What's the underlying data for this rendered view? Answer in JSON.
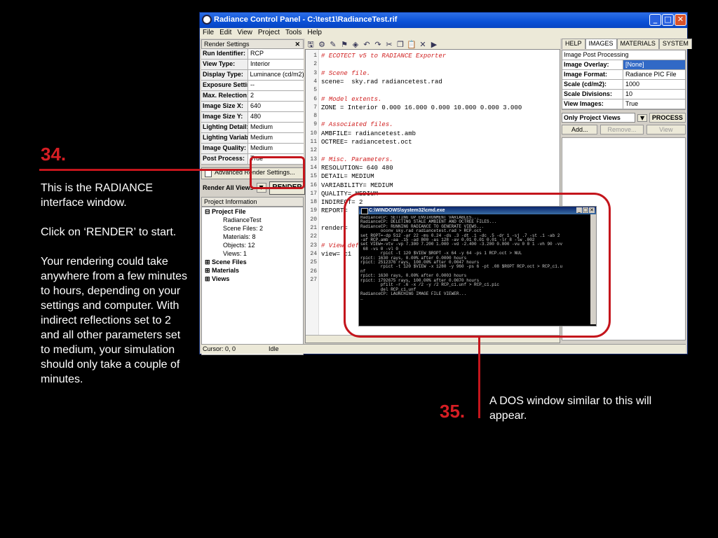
{
  "window": {
    "title": "Radiance Control Panel - C:\\test1\\RadianceTest.rif",
    "menu": [
      "File",
      "Edit",
      "View",
      "Project",
      "Tools",
      "Help"
    ]
  },
  "render_settings": {
    "header": "Render Settings",
    "rows": [
      {
        "label": "Run Identifier:",
        "value": "RCP"
      },
      {
        "label": "View Type:",
        "value": "Interior"
      },
      {
        "label": "Display Type:",
        "value": "Luminance (cd/m2)"
      },
      {
        "label": "Exposure Settin",
        "value": "--"
      },
      {
        "label": "Max. Relection:",
        "value": "2"
      },
      {
        "label": "Image Size X:",
        "value": "640"
      },
      {
        "label": "Image Size Y:",
        "value": "480"
      },
      {
        "label": "Lighting Detail:",
        "value": "Medium"
      },
      {
        "label": "Lighting Variabi",
        "value": "Medium"
      },
      {
        "label": "Image Quality:",
        "value": "Medium"
      },
      {
        "label": "Post Process:",
        "value": "True"
      }
    ],
    "advanced_label": "Advanced Render Settings...",
    "render_views_label": "Render All Views",
    "render_button": "RENDER"
  },
  "project_info": {
    "header": "Project Information",
    "items": [
      "Project File",
      "RadianceTest",
      "Scene Files: 2",
      "Materials: 8",
      "Objects: 12",
      "Views: 1",
      "Scene Files",
      "Materials",
      "Views"
    ]
  },
  "editor": {
    "lines": [
      {
        "n": "1",
        "text": "# ECOTECT v5 to RADIANCE Exporter",
        "comment": true
      },
      {
        "n": "2",
        "text": ""
      },
      {
        "n": "3",
        "text": "# Scene file.",
        "comment": true
      },
      {
        "n": "4",
        "text": "scene=  sky.rad radiancetest.rad"
      },
      {
        "n": "5",
        "text": ""
      },
      {
        "n": "6",
        "text": "# Model extents.",
        "comment": true
      },
      {
        "n": "7",
        "text": "ZONE = Interior 0.000 16.000 0.000 10.000 0.000 3.000"
      },
      {
        "n": "8",
        "text": ""
      },
      {
        "n": "9",
        "text": "# Associated files.",
        "comment": true
      },
      {
        "n": "10",
        "text": "AMBFILE= radiancetest.amb"
      },
      {
        "n": "11",
        "text": "OCTREE= radiancetest.oct"
      },
      {
        "n": "12",
        "text": ""
      },
      {
        "n": "13",
        "text": "# Misc. Parameters.",
        "comment": true
      },
      {
        "n": "14",
        "text": "RESOLUTION= 640 480"
      },
      {
        "n": "15",
        "text": "DETAIL= MEDIUM"
      },
      {
        "n": "16",
        "text": "VARIABILITY= MEDIUM"
      },
      {
        "n": "17",
        "text": "QUALITY= MEDIUM"
      },
      {
        "n": "18",
        "text": "INDIRECT= 2"
      },
      {
        "n": "19",
        "text": "REPORT="
      },
      {
        "n": "20",
        "text": ""
      },
      {
        "n": "21",
        "text": "render="
      },
      {
        "n": "22",
        "text": ""
      },
      {
        "n": "23",
        "text": "# View def",
        "comment": true
      },
      {
        "n": "24",
        "text": "view= c1"
      },
      {
        "n": "25",
        "text": ""
      },
      {
        "n": "26",
        "text": ""
      },
      {
        "n": "27",
        "text": ""
      }
    ]
  },
  "right_panel": {
    "tabs": [
      "HELP",
      "IMAGES",
      "MATERIALS",
      "SYSTEM"
    ],
    "section": "Image Post Processing",
    "rows": [
      {
        "label": "Image Overlay:",
        "value": "[None]"
      },
      {
        "label": "Image Format:",
        "value": "Radiance PIC File"
      },
      {
        "label": "Scale (cd/m2):",
        "value": "1000"
      },
      {
        "label": "Scale Divisions:",
        "value": "10"
      },
      {
        "label": "View Images:",
        "value": "True"
      }
    ],
    "filter": "Only Project Views",
    "process_button": "PROCESS",
    "add_button": "Add...",
    "remove_button": "Remove...",
    "view_button": "View"
  },
  "status": {
    "cursor": "Cursor: 0, 0",
    "state": "Idle"
  },
  "dos": {
    "title": "C:\\WINDOWS\\system32\\cmd.exe",
    "text": "RadianceCP: SETTING UP ENVIRONMENT VARIABLES...\nRadianceCP: DELETING STALE AMBIENT AND OCTREE FILES...\nRadianceCP: RUNNING RADIANCE TO GENERATE VIEWS...\n        oconv sky.rad radiancetest.rad > RCP.oct\nset ROPT=-dp 512 -ar 22 -ms 0.24 -ds .3 -dt .1 -dc .5 -dr 1 -sj .7 -st .1 -ab 2\n-af RCP.amb -aa .15 -ad 800 -as 128 -av 0.01 0.01 0.01 -lr 8 -lw .002\nset VIEW=-vtv -vp 7.300 7.200 1.000 -vd -2.400 -3.200 0.000 -vu 0 0 1 -vh 90 -vv\n 68 -vs 0 -vl 0\n        rpict -t 120 $VIEW $ROPT -x 64 -y 64 -ps 1 RCP.oct > NUL\nrpict: 1630 rays, 0.00% after 0.0000 hours\nrpict: 2512376 rays, 100.00% after 0.0047 hours\n        rpict -t 120 $VIEW -x 1280 -y 960 -ps 6 -pt .08 $ROPT RCP.oct > RCP_c1.u\nnf\nrpict: 1630 rays, 0.00% after 0.0003 hours\nrpict: 1792675 rays, 100.00% after 0.0070 hours\n        pfilt -r .6 -x /2 -y /2 RCP_c1.unf > RCP_c1.pic\n        del RCP_c1.unf\nRadianceCP: LAUNCHING IMAGE FILE VIEWER...\n_"
  },
  "annotations": {
    "step34": "34.",
    "step34_text": [
      "This is the RADIANCE interface window.",
      "Click on ‘RENDER’ to start.",
      "Your rendering could take anywhere from a few minutes to hours, depending on your settings and computer. With indirect reflections set to 2 and all other parameters set to medium, your simulation should only take a couple of minutes."
    ],
    "step35": "35.",
    "step35_text": "A DOS window similar to this will appear."
  },
  "colors": {
    "accent_red": "#d71e24",
    "title_blue": "#0a50d6",
    "comment_red": "#d02020"
  }
}
